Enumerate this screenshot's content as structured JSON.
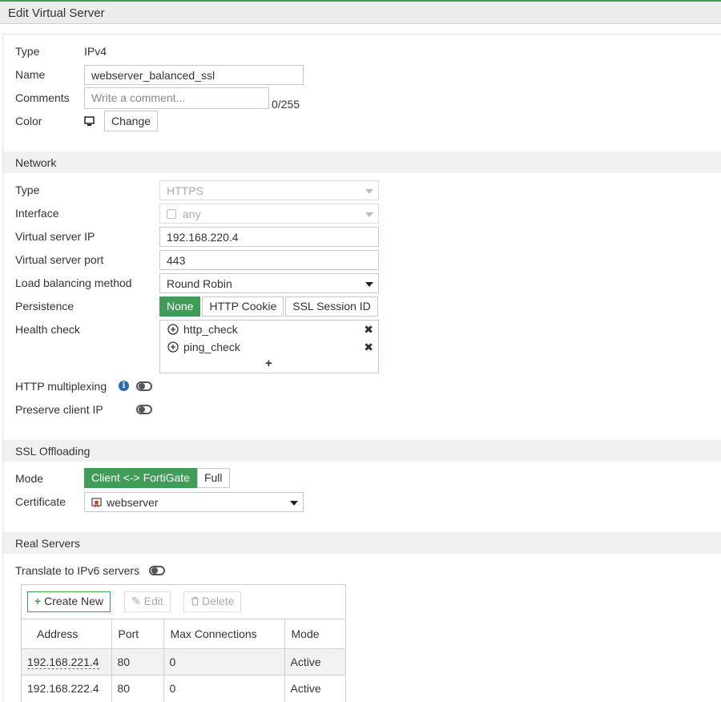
{
  "window": {
    "title": "Edit Virtual Server"
  },
  "general": {
    "type_label": "Type",
    "type_value": "IPv4",
    "name_label": "Name",
    "name_value": "webserver_balanced_ssl",
    "comments_label": "Comments",
    "comments_placeholder": "Write a comment...",
    "comments_counter": "0/255",
    "color_label": "Color",
    "change_button": "Change"
  },
  "network": {
    "section_title": "Network",
    "type_label": "Type",
    "type_value": "HTTPS",
    "interface_label": "Interface",
    "interface_value": "any",
    "vip_label": "Virtual server IP",
    "vip_value": "192.168.220.4",
    "port_label": "Virtual server port",
    "port_value": "443",
    "lb_label": "Load balancing method",
    "lb_value": "Round Robin",
    "persistence_label": "Persistence",
    "persistence_options": [
      "None",
      "HTTP Cookie",
      "SSL Session ID"
    ],
    "persistence_selected": "None",
    "health_label": "Health check",
    "health_checks": [
      "http_check",
      "ping_check"
    ],
    "add_symbol": "+",
    "remove_symbol": "✖",
    "multiplexing_label": "HTTP multiplexing",
    "multiplexing_on": false,
    "preserve_label": "Preserve client IP",
    "preserve_on": false
  },
  "ssl": {
    "section_title": "SSL Offloading",
    "mode_label": "Mode",
    "mode_options": [
      "Client <-> FortiGate",
      "Full"
    ],
    "mode_selected": "Client <-> FortiGate",
    "cert_label": "Certificate",
    "cert_value": "webserver"
  },
  "real_servers": {
    "section_title": "Real Servers",
    "ipv6_label": "Translate to IPv6 servers",
    "ipv6_on": false,
    "toolbar": {
      "create": "Create New",
      "edit": "Edit",
      "delete": "Delete"
    },
    "columns": [
      "Address",
      "Port",
      "Max Connections",
      "Mode"
    ],
    "rows": [
      {
        "address": "192.168.221.4",
        "port": "80",
        "max_conn": "0",
        "mode": "Active"
      },
      {
        "address": "192.168.222.4",
        "port": "80",
        "max_conn": "0",
        "mode": "Active"
      }
    ]
  },
  "colors": {
    "accent": "#3f9d57",
    "section_bg": "#f1f1f1",
    "info": "#2b6cb0"
  }
}
